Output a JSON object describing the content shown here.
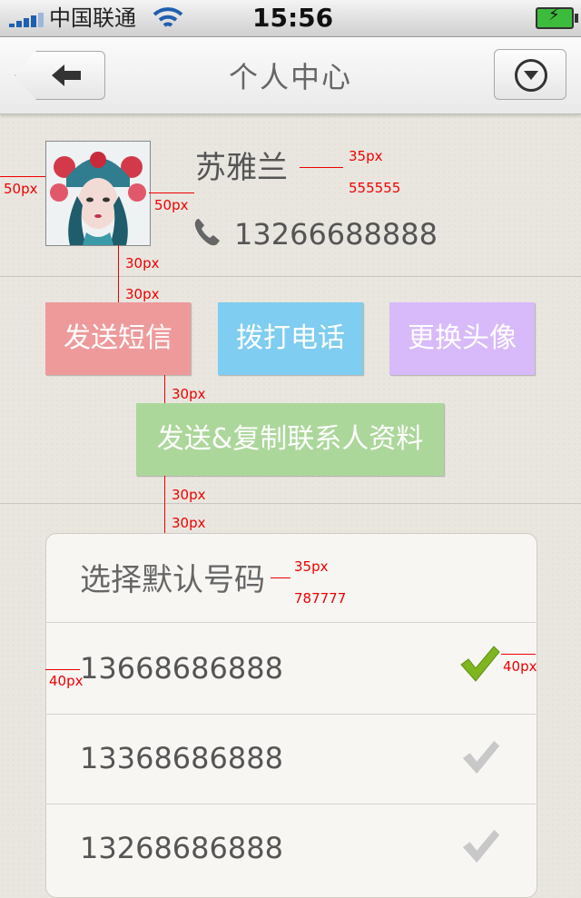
{
  "status_bar": {
    "carrier": "中国联通",
    "time": "15:56",
    "wifi_icon": "wifi-icon",
    "battery_icon": "battery-charging-icon"
  },
  "nav": {
    "title": "个人中心",
    "back_icon": "back-arrow-icon",
    "menu_icon": "dropdown-circle-icon"
  },
  "profile": {
    "name": "苏雅兰",
    "phone": "13266688888",
    "phone_icon": "phone-icon"
  },
  "actions": {
    "sms": "发送短信",
    "call": "拨打电话",
    "change_avatar": "更换头像",
    "copy_contact": "发送&复制联系人资料"
  },
  "number_list": {
    "title": "选择默认号码",
    "items": [
      {
        "number": "13668686888",
        "selected": true
      },
      {
        "number": "13368686888",
        "selected": false
      },
      {
        "number": "13268686888",
        "selected": false
      }
    ]
  },
  "annotations": {
    "a1": "50px",
    "a2": "50px",
    "a3": "35px",
    "a4": "555555",
    "a5": "30px",
    "a6": "30px",
    "a7": "30px",
    "a8": "30px",
    "a9": "30px",
    "a10": "35px",
    "a11": "787777",
    "a12": "40px",
    "a13": "40px"
  },
  "colors": {
    "sms": "#ee9a9b",
    "call": "#7fcdf0",
    "avatar": "#d8bafb",
    "copy": "#acd79b",
    "check_selected": "#7fb51f",
    "check_unselected": "#c8c8c8",
    "annotation": "#ee0000"
  }
}
